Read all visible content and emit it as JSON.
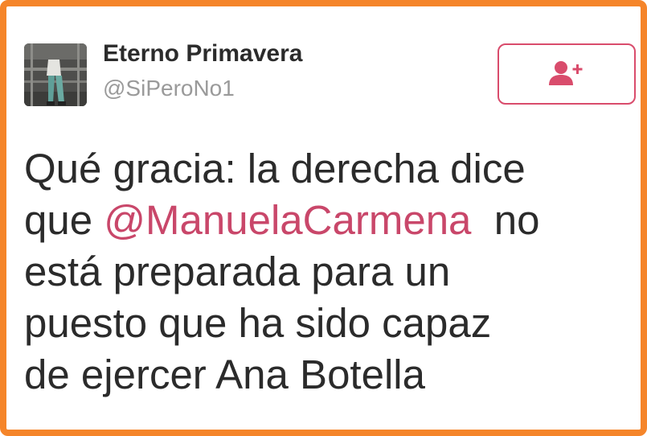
{
  "user": {
    "display_name": "Eterno Primavera",
    "handle": "@SiPeroNo1"
  },
  "follow_button": {
    "icon": "add-user-icon",
    "accent_color": "#d94c6c"
  },
  "tweet": {
    "line1": "Qué gracia: la derecha dice",
    "line2_before": "que ",
    "mention": "@ManuelaCarmena",
    "line2_after": "  no",
    "line3": "está preparada para un",
    "line4": "puesto que ha sido capaz",
    "line5": "de ejercer Ana Botella"
  },
  "colors": {
    "frame_border": "#f5852a",
    "mention": "#c9476a",
    "text": "#2b2b2b",
    "handle": "#9a9a9a"
  }
}
